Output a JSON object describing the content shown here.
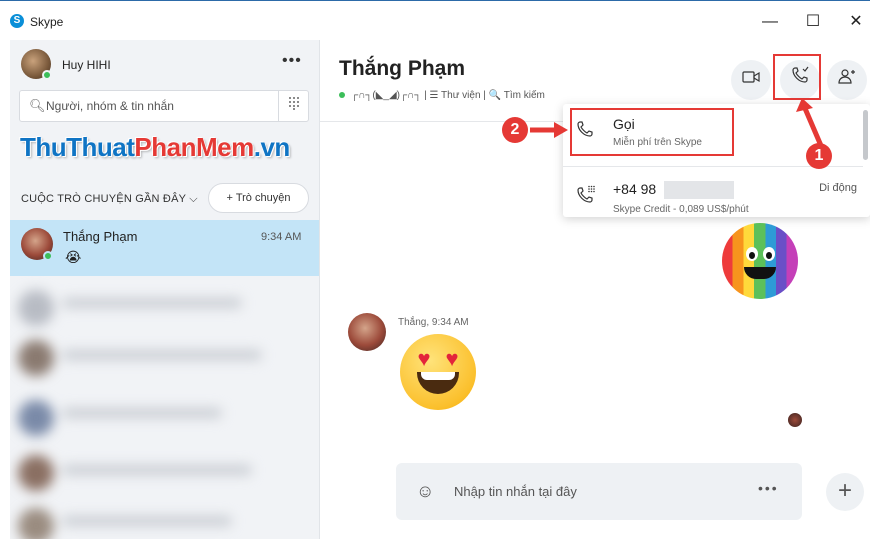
{
  "window": {
    "title": "Skype",
    "logo_letter": "S",
    "minimize": "—",
    "maximize": "☐",
    "close": "✕"
  },
  "profile": {
    "name": "Huy HIHI",
    "more": "•••"
  },
  "search": {
    "placeholder": "Người, nhóm & tin nhắn"
  },
  "watermark": {
    "part1": "ThuThuat",
    "part2": "PhanMem",
    "part3": ".vn"
  },
  "recent": {
    "label": "CUỘC TRÒ CHUYỆN GẦN ĐÂY ⌵",
    "new_chat": "+ Trò chuyện"
  },
  "chat_list": [
    {
      "name": "Thắng Phạm",
      "time": "9:34 AM",
      "preview": "😭"
    }
  ],
  "conversation": {
    "title": "Thắng Phạm",
    "subtitle": "┌∩┐(◣_◢)┌∩┐  |  ☰ Thư viện  |  🔍 Tìm kiếm"
  },
  "call_menu": {
    "items": [
      {
        "title": "Gọi",
        "subtitle": "Miễn phí trên Skype",
        "right": ""
      },
      {
        "title": "+84 98",
        "subtitle": "Skype Credit - 0,089 US$/phút",
        "right": "Di động"
      }
    ]
  },
  "annotations": {
    "step1": "1",
    "step2": "2"
  },
  "message": {
    "meta": "Thắng, 9:34 AM"
  },
  "composer": {
    "placeholder": "Nhập tin nhắn tại đây",
    "more": "•••",
    "add": "+"
  },
  "colors": {
    "accent": "#0a8fd8",
    "highlight": "#e53935",
    "selected_chat": "#c3e4f7",
    "online": "#3cbe5a"
  }
}
